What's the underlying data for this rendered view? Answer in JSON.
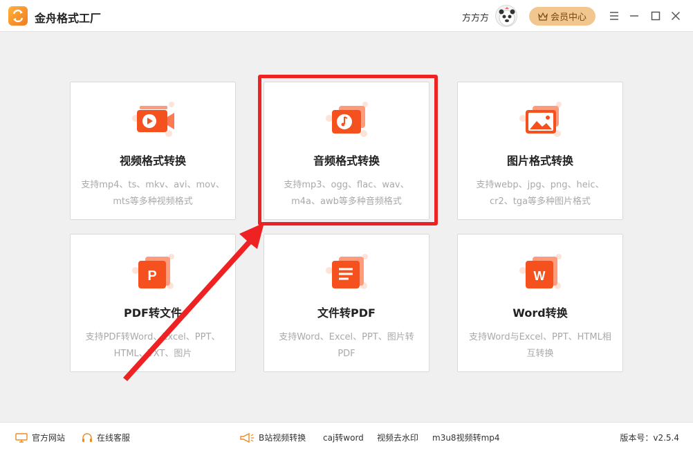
{
  "app": {
    "title": "金舟格式工厂"
  },
  "user": {
    "name": "方方方",
    "vip_label": "会员中心"
  },
  "cards": [
    {
      "title": "视频格式转换",
      "desc": "支持mp4、ts、mkv、avi、mov、mts等多种视频格式"
    },
    {
      "title": "音频格式转换",
      "desc": "支持mp3、ogg、flac、wav、m4a、awb等多种音频格式"
    },
    {
      "title": "图片格式转换",
      "desc": "支持webp、jpg、png、heic、cr2、tga等多种图片格式"
    },
    {
      "title": "PDF转文件",
      "desc": "支持PDF转Word、Excel、PPT、HTML、TXT、图片"
    },
    {
      "title": "文件转PDF",
      "desc": "支持Word、Excel、PPT、图片转PDF"
    },
    {
      "title": "Word转换",
      "desc": "支持Word与Excel、PPT、HTML相互转换"
    }
  ],
  "icons": {
    "pdf_letter": "P",
    "word_letter": "W"
  },
  "footer": {
    "website": "官方网站",
    "support": "在线客服",
    "links": [
      "B站视频转换",
      "caj转word",
      "视频去水印",
      "m3u8视频转mp4"
    ],
    "version": "版本号：v2.5.4"
  },
  "colors": {
    "accent": "#f4511e",
    "highlight": "#ee2222",
    "vip": "#f2c68f"
  }
}
